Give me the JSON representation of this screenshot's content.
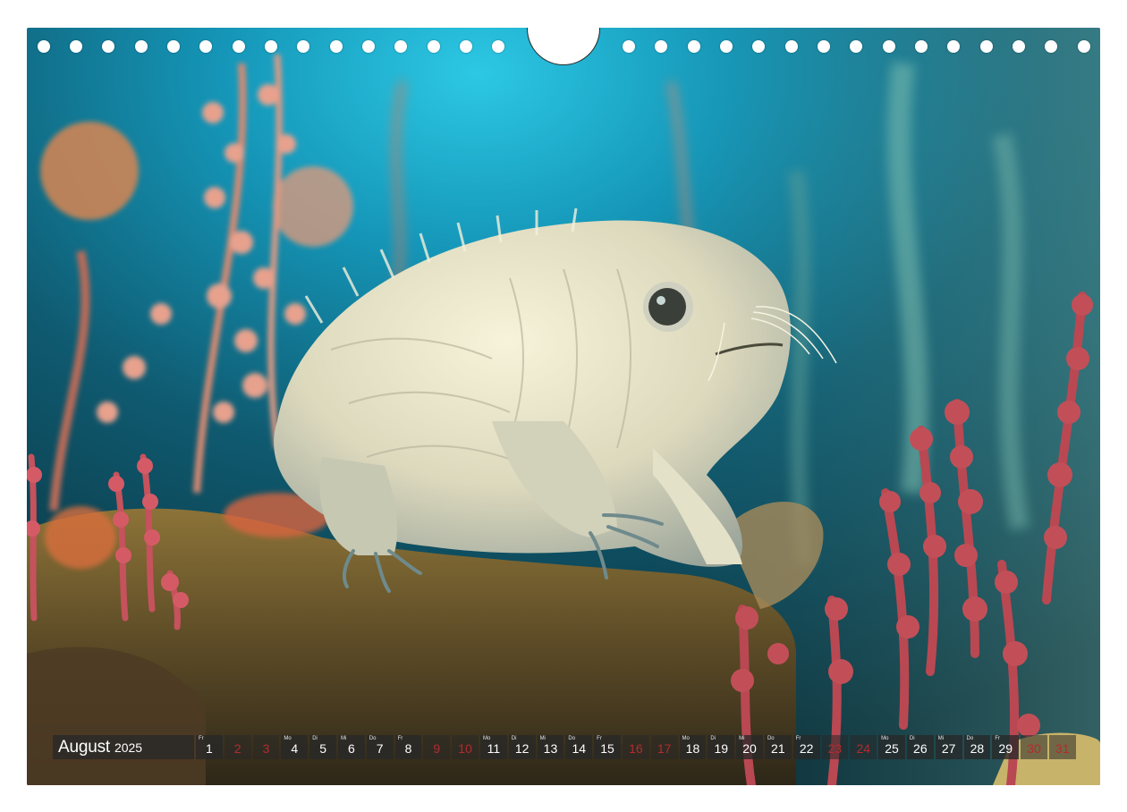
{
  "calendar": {
    "month": "August",
    "year": "2025",
    "days": [
      {
        "n": "1",
        "wd": "Fr",
        "weekend": false
      },
      {
        "n": "2",
        "wd": "",
        "weekend": true
      },
      {
        "n": "3",
        "wd": "",
        "weekend": true
      },
      {
        "n": "4",
        "wd": "Mo",
        "weekend": false
      },
      {
        "n": "5",
        "wd": "Di",
        "weekend": false
      },
      {
        "n": "6",
        "wd": "Mi",
        "weekend": false
      },
      {
        "n": "7",
        "wd": "Do",
        "weekend": false
      },
      {
        "n": "8",
        "wd": "Fr",
        "weekend": false
      },
      {
        "n": "9",
        "wd": "",
        "weekend": true
      },
      {
        "n": "10",
        "wd": "",
        "weekend": true
      },
      {
        "n": "11",
        "wd": "Mo",
        "weekend": false
      },
      {
        "n": "12",
        "wd": "Di",
        "weekend": false
      },
      {
        "n": "13",
        "wd": "Mi",
        "weekend": false
      },
      {
        "n": "14",
        "wd": "Do",
        "weekend": false
      },
      {
        "n": "15",
        "wd": "Fr",
        "weekend": false
      },
      {
        "n": "16",
        "wd": "",
        "weekend": true
      },
      {
        "n": "17",
        "wd": "",
        "weekend": true
      },
      {
        "n": "18",
        "wd": "Mo",
        "weekend": false
      },
      {
        "n": "19",
        "wd": "Di",
        "weekend": false
      },
      {
        "n": "20",
        "wd": "Mi",
        "weekend": false
      },
      {
        "n": "21",
        "wd": "Do",
        "weekend": false
      },
      {
        "n": "22",
        "wd": "Fr",
        "weekend": false
      },
      {
        "n": "23",
        "wd": "",
        "weekend": true
      },
      {
        "n": "24",
        "wd": "",
        "weekend": true
      },
      {
        "n": "25",
        "wd": "Mo",
        "weekend": false
      },
      {
        "n": "26",
        "wd": "Di",
        "weekend": false
      },
      {
        "n": "27",
        "wd": "Mi",
        "weekend": false
      },
      {
        "n": "28",
        "wd": "Do",
        "weekend": false
      },
      {
        "n": "29",
        "wd": "Fr",
        "weekend": false
      },
      {
        "n": "30",
        "wd": "",
        "weekend": true
      },
      {
        "n": "31",
        "wd": "",
        "weekend": true
      }
    ]
  },
  "photo": {
    "subject": "tardigrade-illustration",
    "colors": {
      "water_top": "#1fb6d6",
      "water_deep": "#0b3a4a",
      "creature": "#e6e4cf",
      "coral": "#c85c58",
      "sediment": "#6b5a2e"
    }
  }
}
